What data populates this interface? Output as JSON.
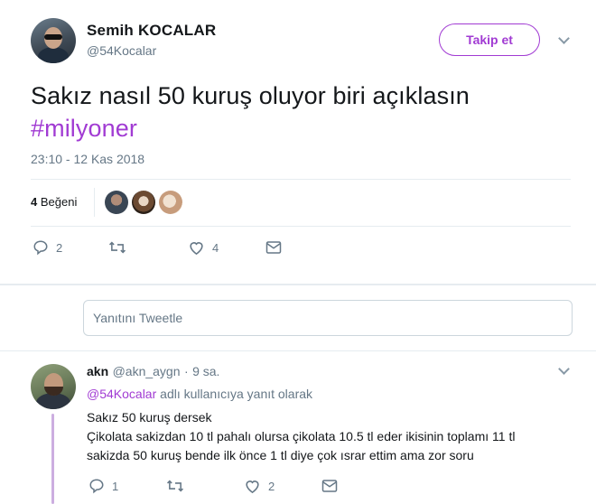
{
  "tweet": {
    "author_name": "Semih KOCALAR",
    "author_handle": "@54Kocalar",
    "follow_label": "Takip et",
    "text_main": "Sakız nasıl 50 kuruş oluyor biri açıklasın",
    "hashtag": "#milyoner",
    "timestamp": "23:10 - 12 Kas 2018",
    "likes_number": "4",
    "likes_label": "Beğeni",
    "actions": {
      "reply_count": "2",
      "retweet_count": "",
      "like_count": "4"
    }
  },
  "reply_box": {
    "placeholder": "Yanıtını Tweetle"
  },
  "reply": {
    "author_name": "akn",
    "author_handle": "@akn_aygn",
    "separator": "·",
    "time": "9 sa.",
    "replying_handle": "@54Kocalar",
    "replying_text": "adlı kullanıcıya yanıt olarak",
    "line1": "Sakız 50 kuruş dersek",
    "line2": "Çikolata sakizdan 10 tl pahalı olursa çikolata 10.5 tl eder ikisinin toplamı 11 tl",
    "line3": "sakizda 50 kuruş bende ilk önce 1 tl diye çok ısrar ettim ama zor soru",
    "actions": {
      "reply_count": "1",
      "retweet_count": "",
      "like_count": "2"
    }
  },
  "colors": {
    "accent": "#a13bd3",
    "secondary_text": "#657786",
    "divider": "#e6ecf0",
    "thread_line": "#ccaee0"
  },
  "icons": [
    "chevron-down-icon",
    "reply-icon",
    "retweet-icon",
    "heart-icon",
    "envelope-icon"
  ]
}
